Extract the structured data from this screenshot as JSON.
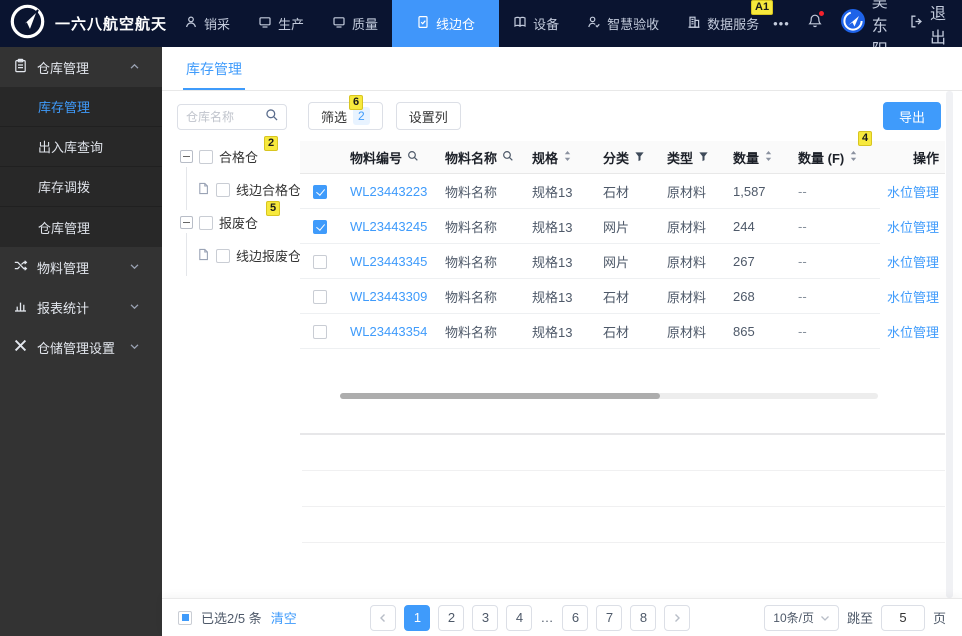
{
  "topnav": {
    "brand": "一六八航空航天",
    "items": [
      {
        "label": "销采"
      },
      {
        "label": "生产"
      },
      {
        "label": "质量"
      },
      {
        "label": "线边仓"
      },
      {
        "label": "设备"
      },
      {
        "label": "智慧验收"
      },
      {
        "label": "数据服务"
      }
    ],
    "more": "•••",
    "user": "吴东阳",
    "logout": "退出"
  },
  "sidebar": {
    "root": {
      "label": "仓库管理"
    },
    "submenu": [
      {
        "label": "库存管理",
        "active": true
      },
      {
        "label": "出入库查询",
        "active": false
      },
      {
        "label": "库存调拨",
        "active": false
      },
      {
        "label": "仓库管理",
        "active": false
      }
    ],
    "groups": [
      {
        "label": "物料管理"
      },
      {
        "label": "报表统计"
      },
      {
        "label": "仓储管理设置"
      }
    ]
  },
  "page": {
    "tab": "库存管理"
  },
  "tree": {
    "search_placeholder": "仓库名称",
    "nodes": [
      {
        "label": "合格仓",
        "children": [
          {
            "label": "线边合格仓"
          }
        ]
      },
      {
        "label": "报废仓",
        "children": [
          {
            "label": "线边报废仓"
          }
        ]
      }
    ]
  },
  "toolbar": {
    "filter": "筛选",
    "filter_count": "2",
    "columns": "设置列",
    "export": "导出"
  },
  "table": {
    "headers": {
      "code": "物料编号",
      "name": "物料名称",
      "spec": "规格",
      "category": "分类",
      "type": "类型",
      "qty": "数量",
      "qty_f": "数量 (F)",
      "action": "操作"
    },
    "rows": [
      {
        "code": "WL23443223",
        "name": "物料名称",
        "spec": "规格13",
        "category": "石材",
        "type": "原材料",
        "qty": "1,587",
        "qty_f": "--",
        "action": "水位管理",
        "checked": true
      },
      {
        "code": "WL23443245",
        "name": "物料名称",
        "spec": "规格13",
        "category": "网片",
        "type": "原材料",
        "qty": "244",
        "qty_f": "--",
        "action": "水位管理",
        "checked": true
      },
      {
        "code": "WL23443345",
        "name": "物料名称",
        "spec": "规格13",
        "category": "网片",
        "type": "原材料",
        "qty": "267",
        "qty_f": "--",
        "action": "水位管理",
        "checked": false
      },
      {
        "code": "WL23443309",
        "name": "物料名称",
        "spec": "规格13",
        "category": "石材",
        "type": "原材料",
        "qty": "268",
        "qty_f": "--",
        "action": "水位管理",
        "checked": false
      },
      {
        "code": "WL23443354",
        "name": "物料名称",
        "spec": "规格13",
        "category": "石材",
        "type": "原材料",
        "qty": "865",
        "qty_f": "--",
        "action": "水位管理",
        "checked": false
      }
    ]
  },
  "footer": {
    "selected": "已选2/5 条",
    "clear": "清空",
    "pages": [
      "1",
      "2",
      "3",
      "4",
      "…",
      "6",
      "7",
      "8"
    ],
    "active_page": "1",
    "page_size": "10条/页",
    "jump_label": "跳至",
    "jump_value": "5",
    "jump_suffix": "页"
  },
  "annotations": {
    "a1": "A1",
    "m6": "6",
    "m2": "2",
    "m5": "5",
    "m4": "4"
  },
  "colors": {
    "primary": "#3f9bfb",
    "nav_bg": "#0a1430",
    "nav_active": "#4096fa",
    "sidebar_bg": "#333333",
    "badge_yellow": "#f7e93d"
  }
}
